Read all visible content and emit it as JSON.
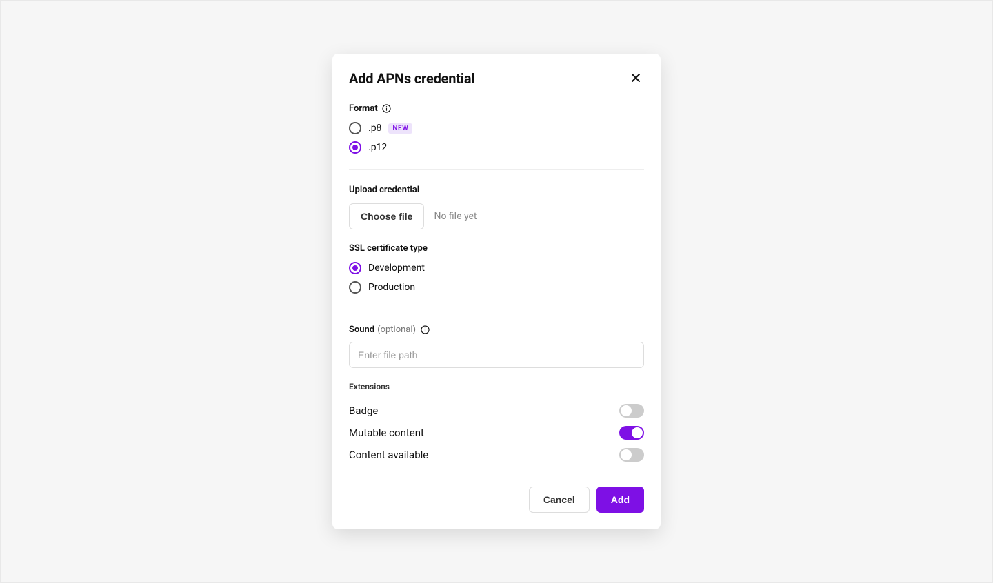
{
  "modal": {
    "title": "Add APNs credential"
  },
  "format": {
    "label": "Format",
    "options": {
      "p8": {
        "label": ".p8",
        "badge": "NEW",
        "selected": false
      },
      "p12": {
        "label": ".p12",
        "selected": true
      }
    }
  },
  "upload": {
    "label": "Upload credential",
    "button": "Choose file",
    "status": "No file yet"
  },
  "ssl": {
    "label": "SSL certificate type",
    "options": {
      "development": {
        "label": "Development",
        "selected": true
      },
      "production": {
        "label": "Production",
        "selected": false
      }
    }
  },
  "sound": {
    "label": "Sound",
    "optional": "(optional)",
    "placeholder": "Enter file path",
    "value": ""
  },
  "extensions": {
    "label": "Extensions",
    "items": {
      "badge": {
        "label": "Badge",
        "on": false
      },
      "mutable": {
        "label": "Mutable content",
        "on": true
      },
      "content": {
        "label": "Content available",
        "on": false
      }
    }
  },
  "footer": {
    "cancel": "Cancel",
    "add": "Add"
  }
}
